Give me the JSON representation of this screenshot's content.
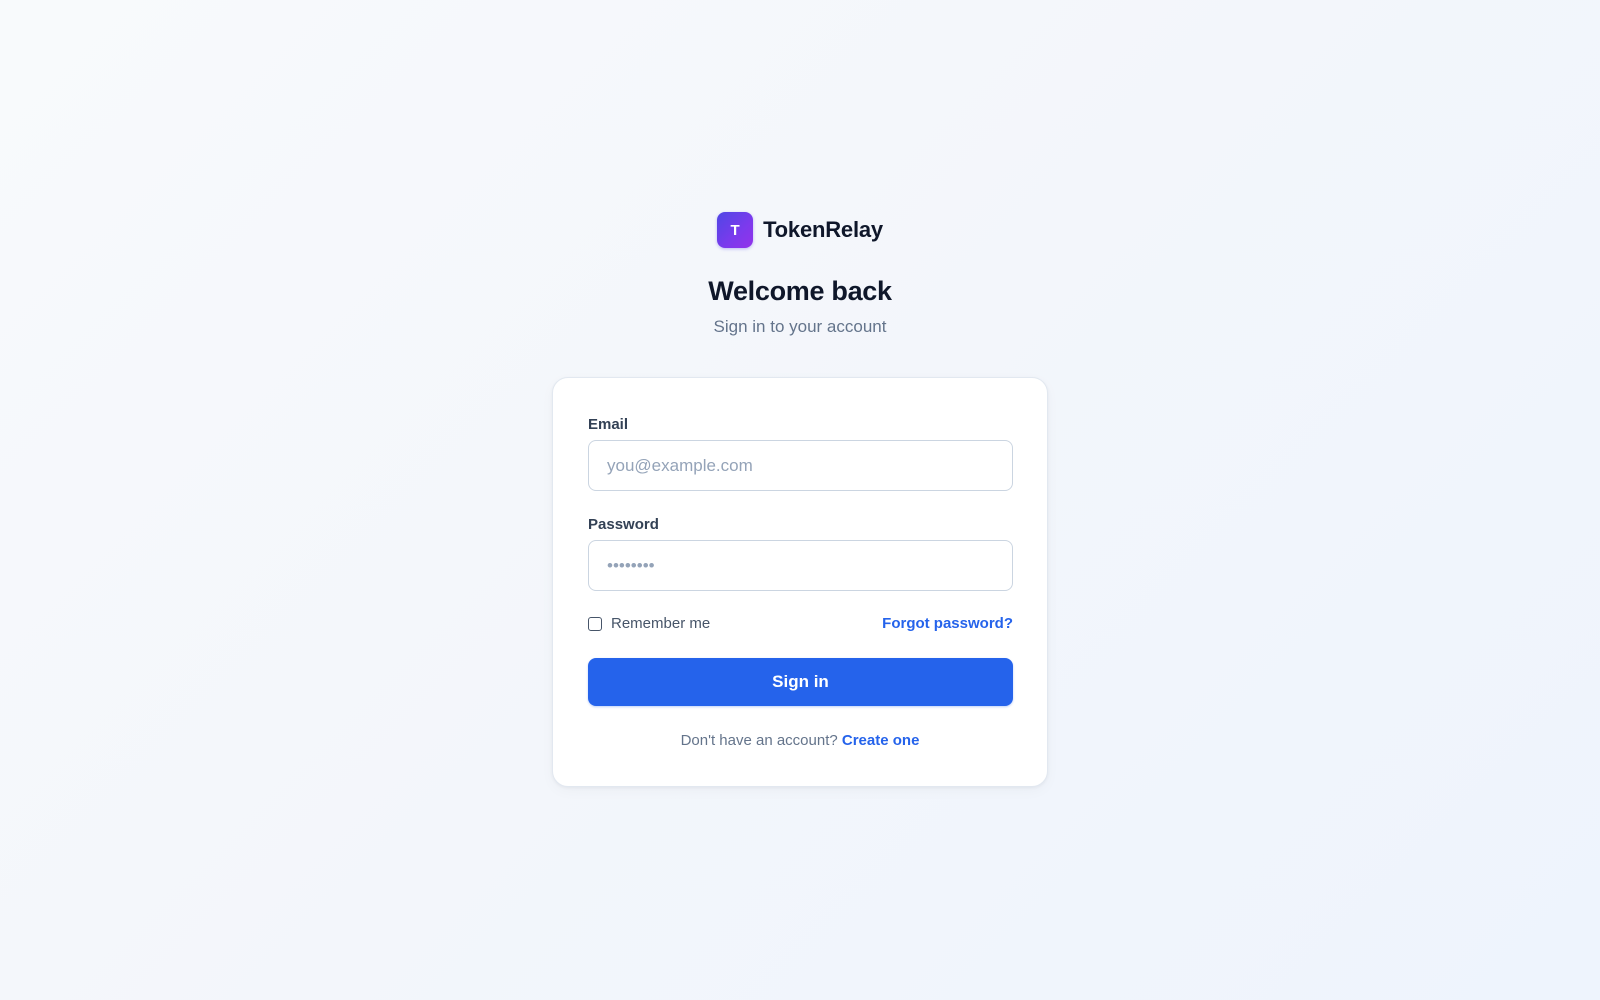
{
  "brand": {
    "logo_letter": "T",
    "name": "TokenRelay"
  },
  "header": {
    "title": "Welcome back",
    "subtitle": "Sign in to your account"
  },
  "form": {
    "email_label": "Email",
    "email_placeholder": "you@example.com",
    "email_value": "",
    "password_label": "Password",
    "password_placeholder": "••••••••",
    "password_value": "",
    "remember_label": "Remember me",
    "remember_checked": false,
    "forgot_label": "Forgot password?",
    "submit_label": "Sign in"
  },
  "footer": {
    "prompt": "Don't have an account?",
    "create_label": "Create one"
  },
  "colors": {
    "primary": "#2563eb",
    "logo_gradient_start": "#4f46e5",
    "logo_gradient_end": "#9333ea",
    "background": "#f3f6fb"
  },
  "icons": {
    "brand_logo": "letter-t-logo-icon",
    "remember_checkbox": "checkbox-icon"
  }
}
